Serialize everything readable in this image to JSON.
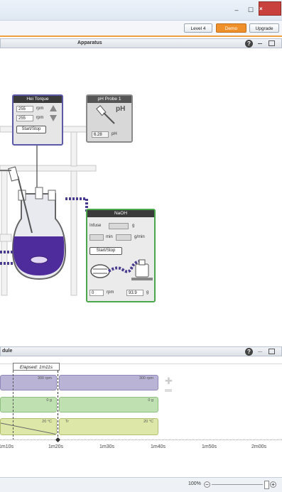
{
  "window": {
    "minimize": "–",
    "restore": "☐",
    "close": "×"
  },
  "toolbar": {
    "level": "Level 4",
    "demo": "Demo",
    "upgrade": "Upgrade",
    "active_color": "#f0902a"
  },
  "apparatus_panel": {
    "title": "Apparatus",
    "help": "?"
  },
  "hei_torque": {
    "title": "Hei Torque",
    "set_rpm": "255",
    "actual_rpm": "255",
    "unit": "rpm",
    "button": "Start/Stop",
    "border_color": "#5a5aa8"
  },
  "ph_probe": {
    "title": "pH Probe 1",
    "label": "pH",
    "value": "6.28",
    "unit": "pH"
  },
  "naoh": {
    "title": "NaOH",
    "infuse_label": "Infuse",
    "infuse_unit": "g",
    "rate_unit_min": "min",
    "rate_unit": "g/min",
    "button": "Start/Stop",
    "pump_rpm": "0",
    "pump_unit": "rpm",
    "balance_value": "93.9",
    "balance_unit": "g",
    "border_color": "#4aa84a"
  },
  "schedule_panel": {
    "title": "dule",
    "help": "?",
    "elapsed": "Elapsed: 1m11s",
    "tracks": [
      {
        "left": "300 rpm",
        "right": "300 rpm",
        "color": "#b9b4d6"
      },
      {
        "left": "0 g",
        "right": "0 g",
        "color": "#bfe0b1"
      },
      {
        "left": "20 °C",
        "mid": "Tr",
        "right": "20 °C",
        "color": "#dde8a8"
      }
    ],
    "ticks": [
      "1m10s",
      "1m20s",
      "1m30s",
      "1m40s",
      "1m50s",
      "2m00s"
    ]
  },
  "status": {
    "zoom": "100%"
  }
}
